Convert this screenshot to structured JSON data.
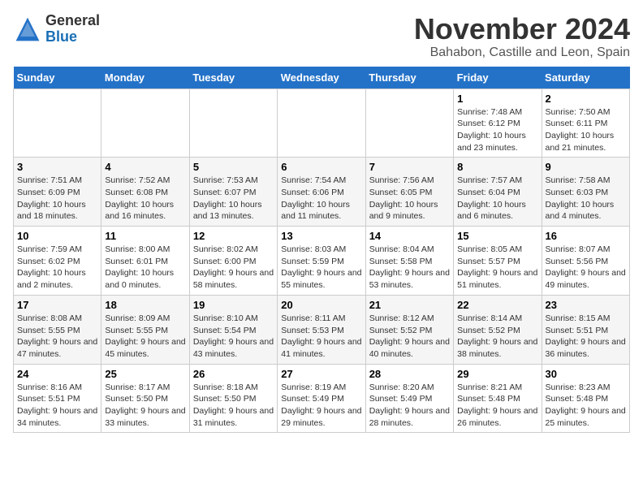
{
  "logo": {
    "general": "General",
    "blue": "Blue"
  },
  "header": {
    "month": "November 2024",
    "location": "Bahabon, Castille and Leon, Spain"
  },
  "days_of_week": [
    "Sunday",
    "Monday",
    "Tuesday",
    "Wednesday",
    "Thursday",
    "Friday",
    "Saturday"
  ],
  "weeks": [
    [
      {
        "day": "",
        "info": ""
      },
      {
        "day": "",
        "info": ""
      },
      {
        "day": "",
        "info": ""
      },
      {
        "day": "",
        "info": ""
      },
      {
        "day": "",
        "info": ""
      },
      {
        "day": "1",
        "info": "Sunrise: 7:48 AM\nSunset: 6:12 PM\nDaylight: 10 hours and 23 minutes."
      },
      {
        "day": "2",
        "info": "Sunrise: 7:50 AM\nSunset: 6:11 PM\nDaylight: 10 hours and 21 minutes."
      }
    ],
    [
      {
        "day": "3",
        "info": "Sunrise: 7:51 AM\nSunset: 6:09 PM\nDaylight: 10 hours and 18 minutes."
      },
      {
        "day": "4",
        "info": "Sunrise: 7:52 AM\nSunset: 6:08 PM\nDaylight: 10 hours and 16 minutes."
      },
      {
        "day": "5",
        "info": "Sunrise: 7:53 AM\nSunset: 6:07 PM\nDaylight: 10 hours and 13 minutes."
      },
      {
        "day": "6",
        "info": "Sunrise: 7:54 AM\nSunset: 6:06 PM\nDaylight: 10 hours and 11 minutes."
      },
      {
        "day": "7",
        "info": "Sunrise: 7:56 AM\nSunset: 6:05 PM\nDaylight: 10 hours and 9 minutes."
      },
      {
        "day": "8",
        "info": "Sunrise: 7:57 AM\nSunset: 6:04 PM\nDaylight: 10 hours and 6 minutes."
      },
      {
        "day": "9",
        "info": "Sunrise: 7:58 AM\nSunset: 6:03 PM\nDaylight: 10 hours and 4 minutes."
      }
    ],
    [
      {
        "day": "10",
        "info": "Sunrise: 7:59 AM\nSunset: 6:02 PM\nDaylight: 10 hours and 2 minutes."
      },
      {
        "day": "11",
        "info": "Sunrise: 8:00 AM\nSunset: 6:01 PM\nDaylight: 10 hours and 0 minutes."
      },
      {
        "day": "12",
        "info": "Sunrise: 8:02 AM\nSunset: 6:00 PM\nDaylight: 9 hours and 58 minutes."
      },
      {
        "day": "13",
        "info": "Sunrise: 8:03 AM\nSunset: 5:59 PM\nDaylight: 9 hours and 55 minutes."
      },
      {
        "day": "14",
        "info": "Sunrise: 8:04 AM\nSunset: 5:58 PM\nDaylight: 9 hours and 53 minutes."
      },
      {
        "day": "15",
        "info": "Sunrise: 8:05 AM\nSunset: 5:57 PM\nDaylight: 9 hours and 51 minutes."
      },
      {
        "day": "16",
        "info": "Sunrise: 8:07 AM\nSunset: 5:56 PM\nDaylight: 9 hours and 49 minutes."
      }
    ],
    [
      {
        "day": "17",
        "info": "Sunrise: 8:08 AM\nSunset: 5:55 PM\nDaylight: 9 hours and 47 minutes."
      },
      {
        "day": "18",
        "info": "Sunrise: 8:09 AM\nSunset: 5:55 PM\nDaylight: 9 hours and 45 minutes."
      },
      {
        "day": "19",
        "info": "Sunrise: 8:10 AM\nSunset: 5:54 PM\nDaylight: 9 hours and 43 minutes."
      },
      {
        "day": "20",
        "info": "Sunrise: 8:11 AM\nSunset: 5:53 PM\nDaylight: 9 hours and 41 minutes."
      },
      {
        "day": "21",
        "info": "Sunrise: 8:12 AM\nSunset: 5:52 PM\nDaylight: 9 hours and 40 minutes."
      },
      {
        "day": "22",
        "info": "Sunrise: 8:14 AM\nSunset: 5:52 PM\nDaylight: 9 hours and 38 minutes."
      },
      {
        "day": "23",
        "info": "Sunrise: 8:15 AM\nSunset: 5:51 PM\nDaylight: 9 hours and 36 minutes."
      }
    ],
    [
      {
        "day": "24",
        "info": "Sunrise: 8:16 AM\nSunset: 5:51 PM\nDaylight: 9 hours and 34 minutes."
      },
      {
        "day": "25",
        "info": "Sunrise: 8:17 AM\nSunset: 5:50 PM\nDaylight: 9 hours and 33 minutes."
      },
      {
        "day": "26",
        "info": "Sunrise: 8:18 AM\nSunset: 5:50 PM\nDaylight: 9 hours and 31 minutes."
      },
      {
        "day": "27",
        "info": "Sunrise: 8:19 AM\nSunset: 5:49 PM\nDaylight: 9 hours and 29 minutes."
      },
      {
        "day": "28",
        "info": "Sunrise: 8:20 AM\nSunset: 5:49 PM\nDaylight: 9 hours and 28 minutes."
      },
      {
        "day": "29",
        "info": "Sunrise: 8:21 AM\nSunset: 5:48 PM\nDaylight: 9 hours and 26 minutes."
      },
      {
        "day": "30",
        "info": "Sunrise: 8:23 AM\nSunset: 5:48 PM\nDaylight: 9 hours and 25 minutes."
      }
    ]
  ]
}
